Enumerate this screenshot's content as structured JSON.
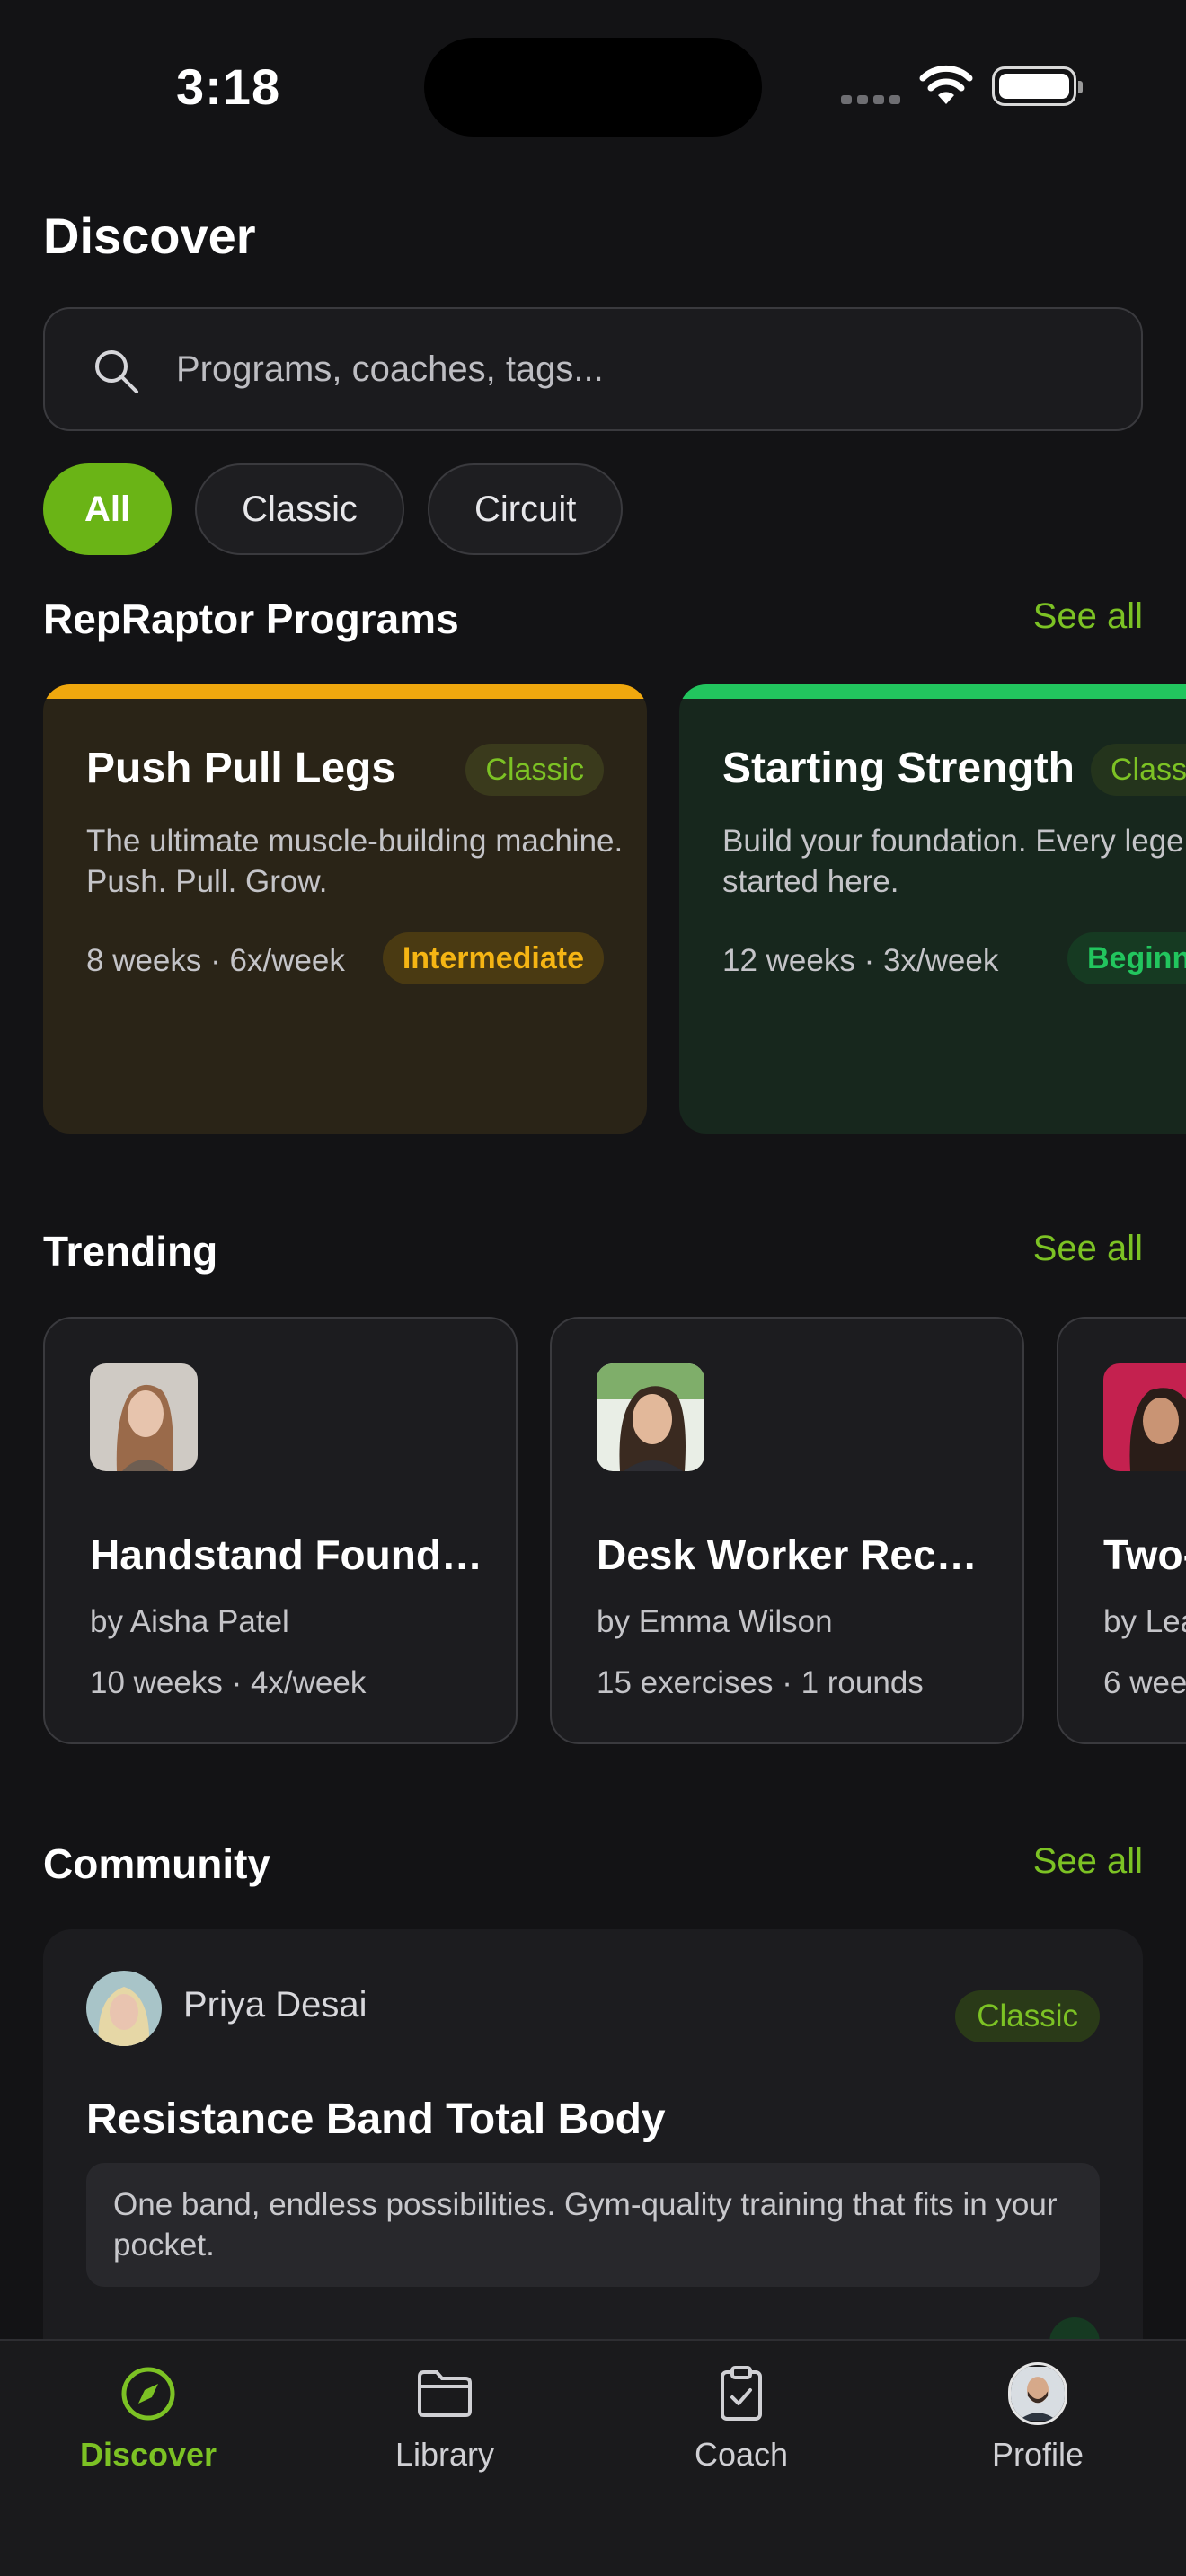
{
  "status": {
    "time": "3:18"
  },
  "page_title": "Discover",
  "search": {
    "placeholder": "Programs, coaches, tags..."
  },
  "filters": [
    "All",
    "Classic",
    "Circuit"
  ],
  "programs": {
    "title": "RepRaptor Programs",
    "see_all": "See all",
    "cards": [
      {
        "title": "Push Pull Legs",
        "tag": "Classic",
        "desc": "The ultimate muscle-building machine. Push. Pull. Grow.",
        "meta": "8 weeks · 6x/week",
        "level": "Intermediate",
        "accent": "#f0a80e",
        "bg": "#2a2417"
      },
      {
        "title": "Starting Strength",
        "tag": "Classic",
        "desc": "Build your foundation. Every legend started here.",
        "meta": "12 weeks · 3x/week",
        "level": "Beginner",
        "accent": "#22c55e",
        "bg": "#17271d"
      }
    ]
  },
  "trending": {
    "title": "Trending",
    "see_all": "See all",
    "cards": [
      {
        "title": "Handstand Foundations",
        "by": "by Aisha Patel",
        "meta": "10 weeks · 4x/week"
      },
      {
        "title": "Desk Worker Recovery",
        "by": "by Emma Wilson",
        "meta": "15 exercises · 1 rounds"
      },
      {
        "title": "Two-",
        "by": "by Lea",
        "meta": "6 wee"
      }
    ]
  },
  "community": {
    "title": "Community",
    "see_all": "See all",
    "card": {
      "author": "Priya Desai",
      "tag": "Classic",
      "title": "Resistance Band Total Body",
      "desc": "One band, endless possibilities. Gym-quality training that fits in your pocket.",
      "meta": "",
      "level": ""
    }
  },
  "nav": [
    {
      "label": "Discover",
      "icon": "compass-icon"
    },
    {
      "label": "Library",
      "icon": "folder-icon"
    },
    {
      "label": "Coach",
      "icon": "clipboard-check-icon"
    },
    {
      "label": "Profile",
      "icon": "avatar"
    }
  ],
  "colors": {
    "accent": "#7cc224",
    "chip_active": "#6ab416",
    "background": "#131315"
  }
}
